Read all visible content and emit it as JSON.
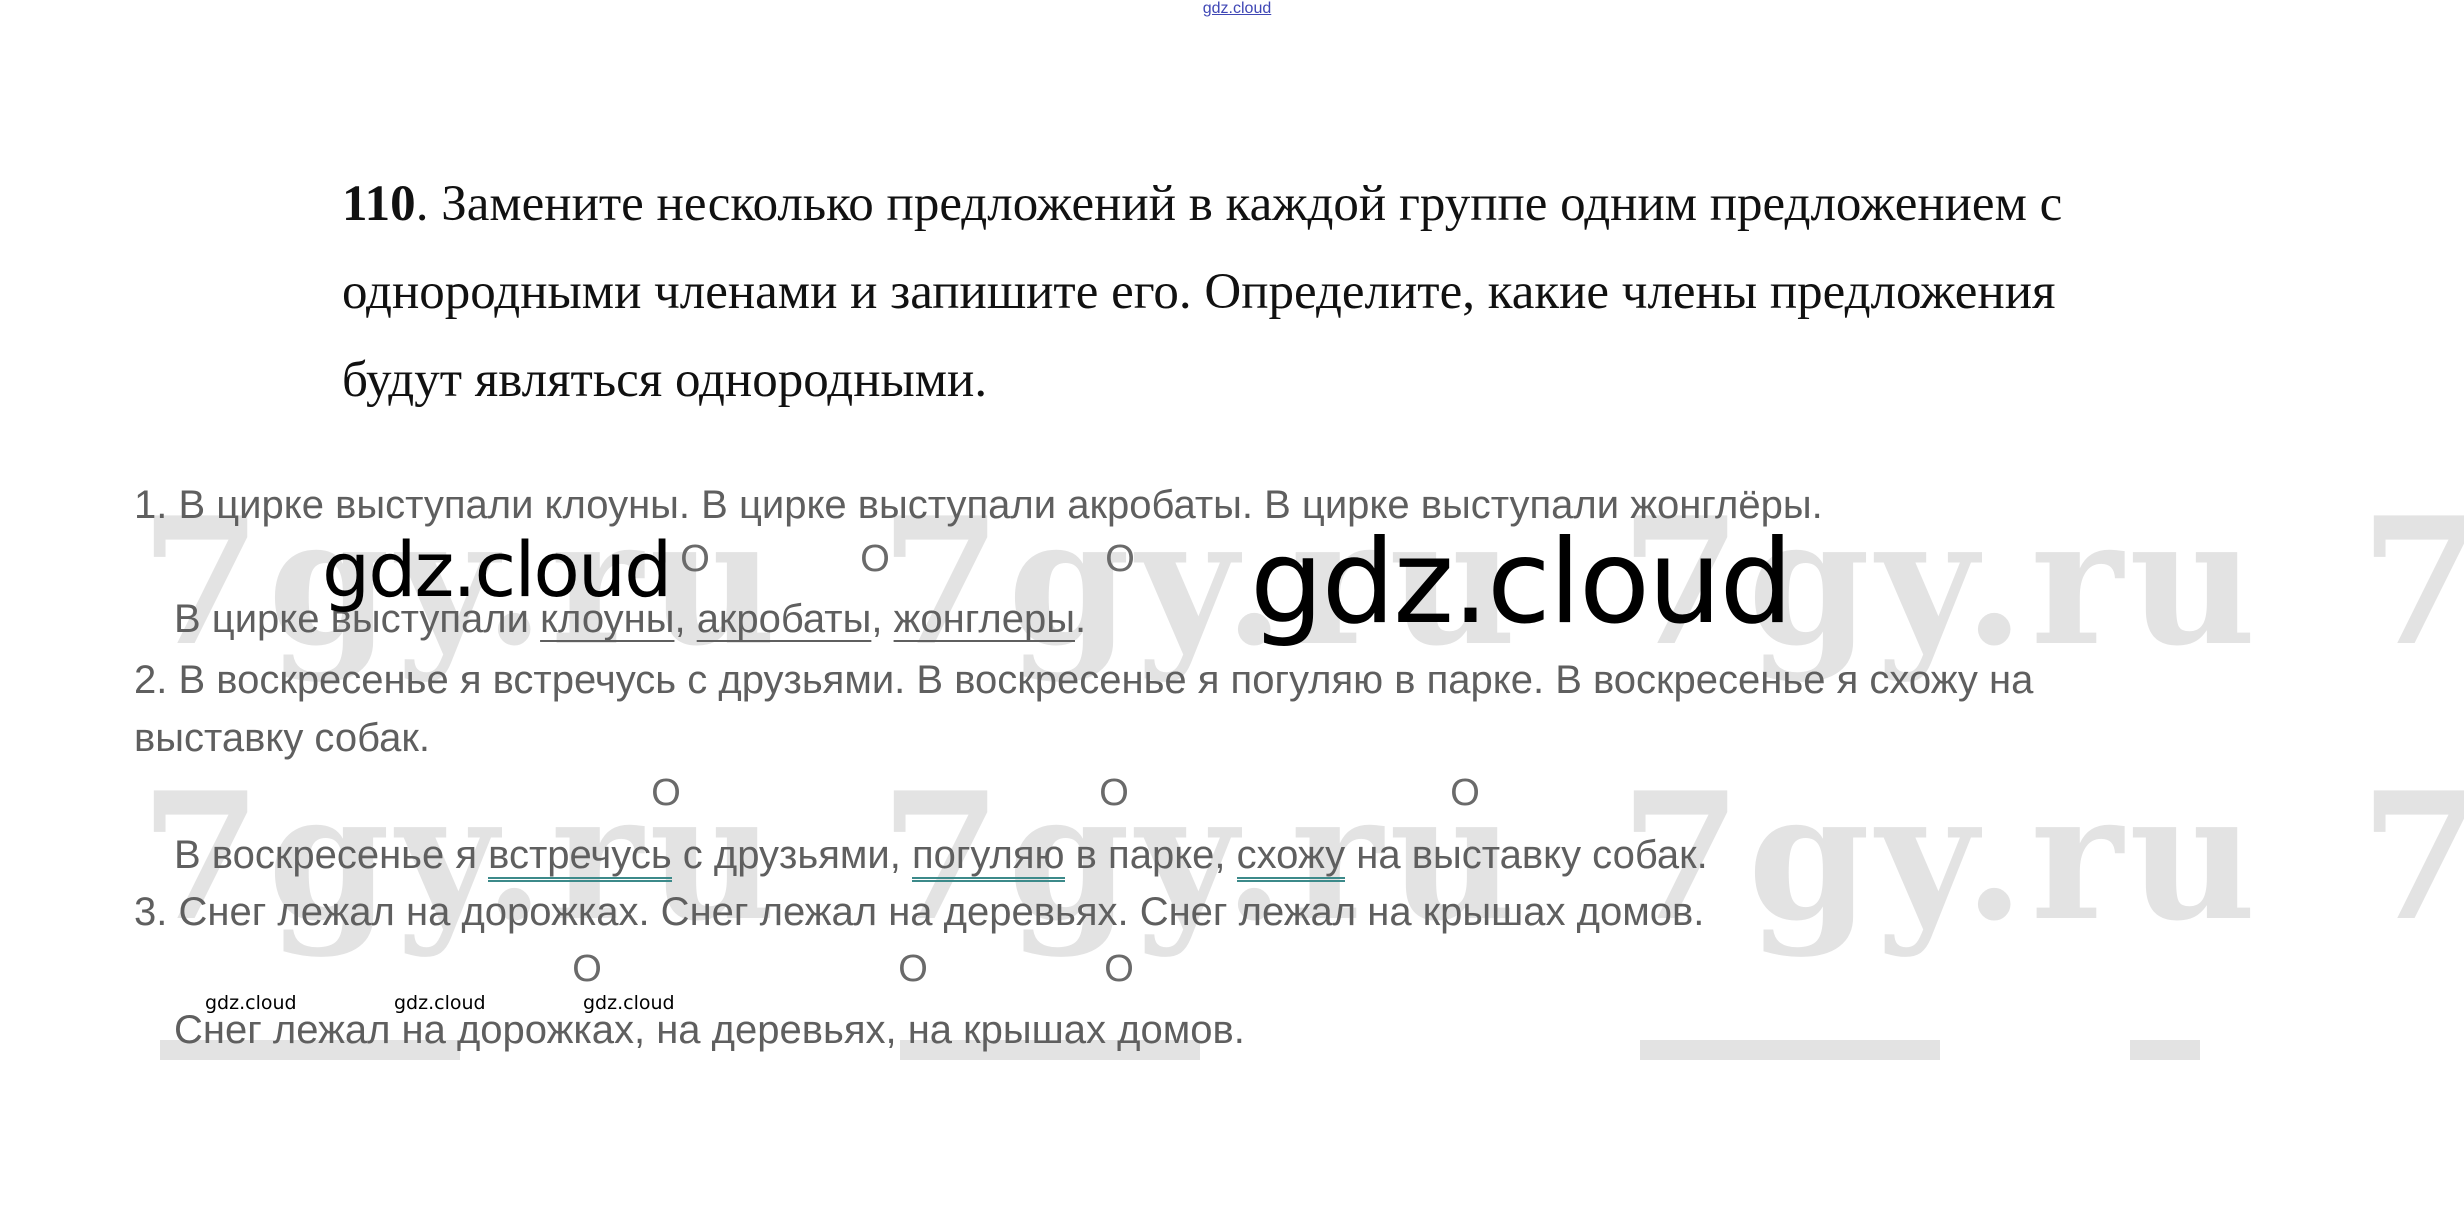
{
  "top_watermark": "gdz.cloud",
  "bg_watermark": "7gy.ru",
  "task": {
    "number": "110",
    "text": ". Замените несколько предложений в каждой группе одним предложением с однородными членами и запишите его. Определите, какие члены предложения будут являться однородными."
  },
  "items": [
    {
      "prompt": "1. В цирке выступали клоуны. В цирке выступали акробаты. В цирке выступали жонглёры.",
      "answer": {
        "start": "В цирке выступали ",
        "w1": "клоуны",
        "s1": ", ",
        "w2": "акробаты",
        "s2": ", ",
        "w3": "жонглеры",
        "end": "."
      }
    },
    {
      "prompt_line1": "2. В воскресенье я встречусь с друзьями. В воскресенье я погуляю в парке. В воскресенье я схожу на",
      "prompt_line2": "выставку собак.",
      "answer": {
        "start": "В воскресенье я ",
        "w1": "встречусь",
        "s1": " с друзьями, ",
        "w2": "погуляю",
        "s2": " в парке, ",
        "w3": "схожу",
        "end": " на выставку собак."
      }
    },
    {
      "prompt": "3. Снег лежал на дорожках. Снег лежал на деревьях. Снег лежал на крышах домов.",
      "answer": "Снег лежал на дорожках, на деревьях, на крышах домов."
    }
  ],
  "o_mark": "О",
  "logos": {
    "large_left": "gdz.cloud",
    "large_right": "gdz.cloud",
    "small": [
      "gdz.cloud",
      "gdz.cloud",
      "gdz.cloud"
    ]
  }
}
